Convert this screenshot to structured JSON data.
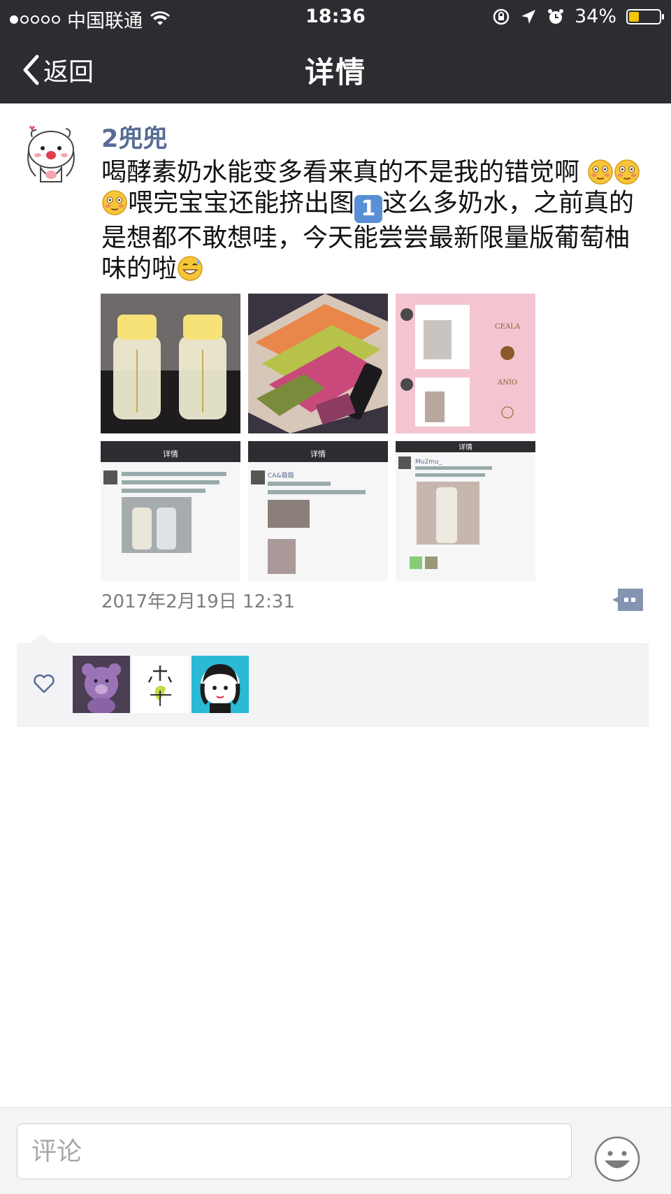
{
  "status_bar": {
    "carrier": "中国联通",
    "time": "18:36",
    "battery": "34%",
    "battery_level": 0.34
  },
  "nav": {
    "back_label": "返回",
    "title": "详情"
  },
  "post": {
    "author": "2兜兜",
    "text_parts": [
      "喝酵素奶水能变多看来真的不是我的错觉啊",
      "喂完宝宝还能挤出图",
      "1",
      "这么多奶水，之前真的是想都不敢想哇，今天能尝尝最新限量版葡萄柚味的啦"
    ],
    "timestamp": "2017年2月19日 12:31",
    "images": [
      {
        "name": "milk-bottles-photo"
      },
      {
        "name": "product-boxes-photo"
      },
      {
        "name": "pink-chat-collage"
      },
      {
        "name": "chat-screenshot-1"
      },
      {
        "name": "chat-screenshot-2"
      },
      {
        "name": "chat-screenshot-3"
      }
    ],
    "screenshot_texts": {
      "s1_title": "详情",
      "s2_title": "详情",
      "s3_title": "详情",
      "s2_user": "CA&薇薇",
      "s3_user": "Mu2mu_"
    }
  },
  "likes": {
    "count": 3
  },
  "comment_bar": {
    "placeholder": "评论"
  },
  "colors": {
    "header_bg": "#2c2d31",
    "username": "#576b95",
    "likes_bg": "#f3f3f5"
  }
}
